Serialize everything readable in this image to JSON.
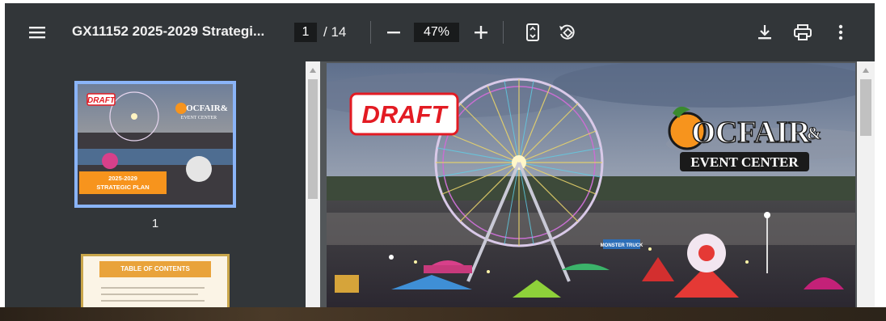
{
  "toolbar": {
    "title": "GX11152 2025-2029 Strategi...",
    "page_current": "1",
    "page_total": "/ 14",
    "zoom": "47%"
  },
  "sidebar": {
    "thumbnails": [
      {
        "label": "1",
        "draft": "DRAFT",
        "logo": "OCFAIR&",
        "logo_sub": "EVENT CENTER",
        "banner": "2025-2029\nSTRATEGIC PLAN"
      },
      {
        "heading": "TABLE OF CONTENTS"
      }
    ]
  },
  "page": {
    "draft": "DRAFT",
    "logo_main": "OCFAIR",
    "logo_amp": "&",
    "logo_sub": "EVENT CENTER",
    "sign": "MONSTER TRUCK"
  },
  "colors": {
    "toolbar": "#323639",
    "viewer_bg": "#525659",
    "accent": "#8ab4f8",
    "draft_red": "#e31b23",
    "orange": "#f7941d"
  }
}
